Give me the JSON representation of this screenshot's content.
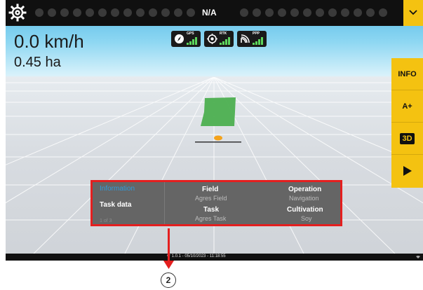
{
  "topbar": {
    "status": "N/A",
    "menu_icon": "chevron-down-icon",
    "settings_icon": "gear-icon"
  },
  "readouts": {
    "speed": "0.0 km/h",
    "area": "0.45 ha"
  },
  "signals": [
    {
      "label": "GPS",
      "icon": "compass-icon"
    },
    {
      "label": "RTK",
      "icon": "crosshair-icon"
    },
    {
      "label": "PPP",
      "icon": "satellite-icon"
    }
  ],
  "sidebar": {
    "info_label": "INFO",
    "zoom_label": "A+",
    "view_label": "3D",
    "play_icon": "play-icon"
  },
  "info_panel": {
    "tabs": [
      "Information",
      "Task data"
    ],
    "pager": "1 of 3",
    "field_label": "Field",
    "field_value": "Agres Field",
    "operation_label": "Operation",
    "operation_value": "Navigation",
    "task_label": "Task",
    "task_value": "Agres Task",
    "cultivation_label": "Cultivation",
    "cultivation_value": "Soy"
  },
  "footer": {
    "version": "vr 1.0.1 - 05/10/2023 - 11:18:55"
  },
  "callout": {
    "number": "2"
  },
  "colors": {
    "accent": "#f4c211",
    "highlight": "#e41f1f",
    "field_polygon": "#4caf50",
    "info_tab_active": "#2e9bdc"
  }
}
